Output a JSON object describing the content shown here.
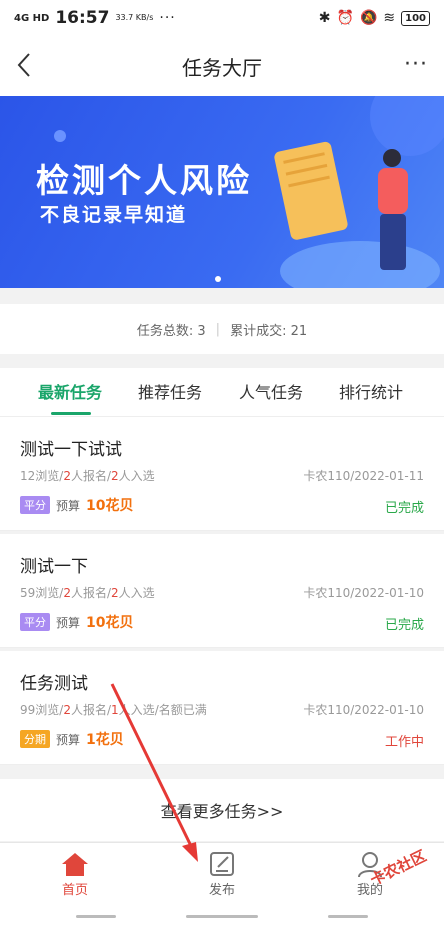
{
  "status_bar": {
    "signal": "4G HD",
    "time": "16:57",
    "speed": "33.7 KB/s",
    "dots": "···",
    "battery": "100"
  },
  "header": {
    "title": "任务大厅",
    "more_label": "···"
  },
  "banner": {
    "headline": "检测个人风险",
    "subline": "不良记录早知道"
  },
  "stats": {
    "total_label": "任务总数:",
    "total_value": "3",
    "sep": "|",
    "deals_label": "累计成交:",
    "deals_value": "21"
  },
  "tabs": [
    "最新任务",
    "推荐任务",
    "人气任务",
    "排行统计"
  ],
  "tasks": [
    {
      "title": "测试一下试试",
      "views": "12浏览",
      "signups": "2",
      "signups_suffix": "人报名",
      "selected": "2",
      "selected_suffix": "人入选",
      "extra": "",
      "author_date": "卡农110/2022-01-11",
      "badge": "平分",
      "badge_color": "#a98bf2",
      "budget_label": "预算",
      "budget": "10花贝",
      "status": "已完成",
      "status_color": "#2aa84a"
    },
    {
      "title": "测试一下",
      "views": "59浏览",
      "signups": "2",
      "signups_suffix": "人报名",
      "selected": "2",
      "selected_suffix": "人入选",
      "extra": "",
      "author_date": "卡农110/2022-01-10",
      "badge": "平分",
      "badge_color": "#a98bf2",
      "budget_label": "预算",
      "budget": "10花贝",
      "status": "已完成",
      "status_color": "#2aa84a"
    },
    {
      "title": "任务测试",
      "views": "99浏览",
      "signups": "2",
      "signups_suffix": "人报名",
      "selected": "1",
      "selected_suffix": "人入选",
      "extra": "/名额已满",
      "author_date": "卡农110/2022-01-10",
      "badge": "分期",
      "badge_color": "#f5a623",
      "budget_label": "预算",
      "budget": "1花贝",
      "status": "工作中",
      "status_color": "#e0463b"
    }
  ],
  "more_tasks": "查看更多任务>>",
  "tabbar": {
    "home": "首页",
    "publish": "发布",
    "me": "我的"
  },
  "watermark": "卡农社区",
  "colors": {
    "accent": "#1aa56a",
    "banner": "#2b55e8",
    "price": "#f2700e",
    "red": "#e0463b"
  }
}
